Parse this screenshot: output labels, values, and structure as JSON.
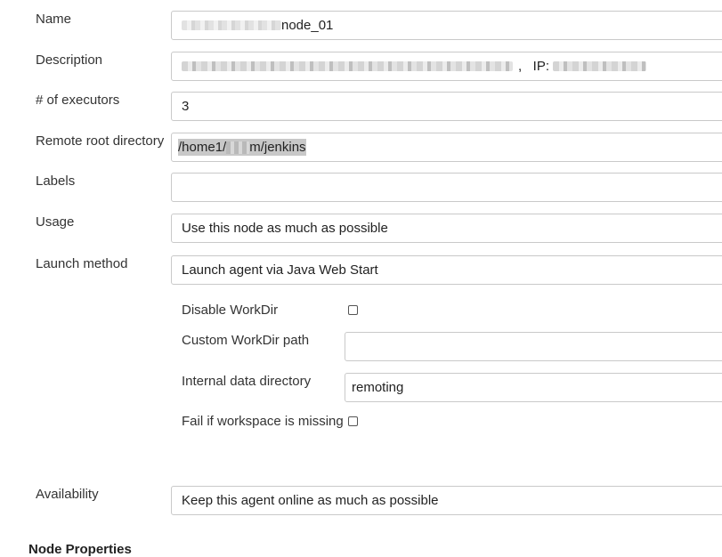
{
  "form": {
    "name": {
      "label": "Name",
      "value": "node_01"
    },
    "description": {
      "label": "Description",
      "ip_label": ",   IP:"
    },
    "executors": {
      "label": "# of executors",
      "value": "3"
    },
    "remote_root": {
      "label": "Remote root directory",
      "value_prefix": "/home1/",
      "value_suffix": "m/jenkins"
    },
    "labels": {
      "label": "Labels",
      "value": ""
    },
    "usage": {
      "label": "Usage",
      "value": "Use this node as much as possible"
    },
    "launch_method": {
      "label": "Launch method",
      "value": "Launch agent via Java Web Start",
      "disable_workdir": {
        "label": "Disable WorkDir",
        "checked": false
      },
      "custom_workdir": {
        "label": "Custom WorkDir path",
        "value": ""
      },
      "internal_data_dir": {
        "label": "Internal data directory",
        "value": "remoting"
      },
      "fail_if_missing": {
        "label": "Fail if workspace is missing",
        "checked": false
      }
    },
    "availability": {
      "label": "Availability",
      "value": "Keep this agent online as much as possible"
    },
    "node_properties": {
      "label": "Node Properties"
    }
  }
}
